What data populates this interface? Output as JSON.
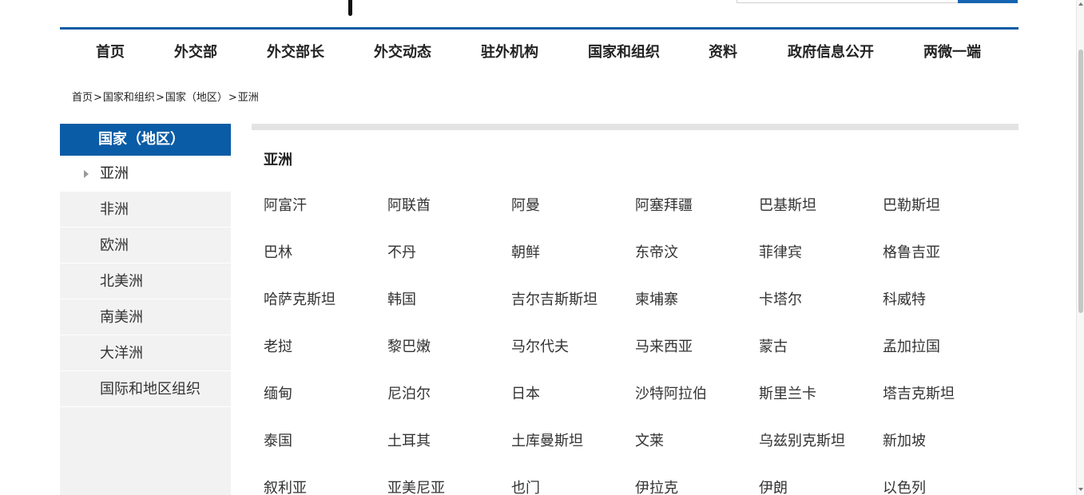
{
  "nav": {
    "items": [
      "首页",
      "外交部",
      "外交部长",
      "外交动态",
      "驻外机构",
      "国家和组织",
      "资料",
      "政府信息公开",
      "两微一端"
    ]
  },
  "breadcrumb": {
    "items": [
      "首页",
      "国家和组织",
      "国家（地区）",
      "亚洲"
    ],
    "separator": ">"
  },
  "sidebar": {
    "title": "国家（地区）",
    "items": [
      "亚洲",
      "非洲",
      "欧洲",
      "北美洲",
      "南美洲",
      "大洋洲",
      "国际和地区组织"
    ],
    "active_index": 0
  },
  "content": {
    "title": "亚洲",
    "countries": [
      "阿富汗",
      "阿联酋",
      "阿曼",
      "阿塞拜疆",
      "巴基斯坦",
      "巴勒斯坦",
      "巴林",
      "不丹",
      "朝鲜",
      "东帝汶",
      "菲律宾",
      "格鲁吉亚",
      "哈萨克斯坦",
      "韩国",
      "吉尔吉斯斯坦",
      "柬埔寨",
      "卡塔尔",
      "科威特",
      "老挝",
      "黎巴嫩",
      "马尔代夫",
      "马来西亚",
      "蒙古",
      "孟加拉国",
      "缅甸",
      "尼泊尔",
      "日本",
      "沙特阿拉伯",
      "斯里兰卡",
      "塔吉克斯坦",
      "泰国",
      "土耳其",
      "土库曼斯坦",
      "文莱",
      "乌兹别克斯坦",
      "新加坡",
      "叙利亚",
      "亚美尼亚",
      "也门",
      "伊拉克",
      "伊朗",
      "以色列"
    ]
  },
  "colors": {
    "brand_blue": "#0b5ca6",
    "sidebar_bg": "#f2f2f2",
    "divider_gray": "#e3e3e3"
  }
}
